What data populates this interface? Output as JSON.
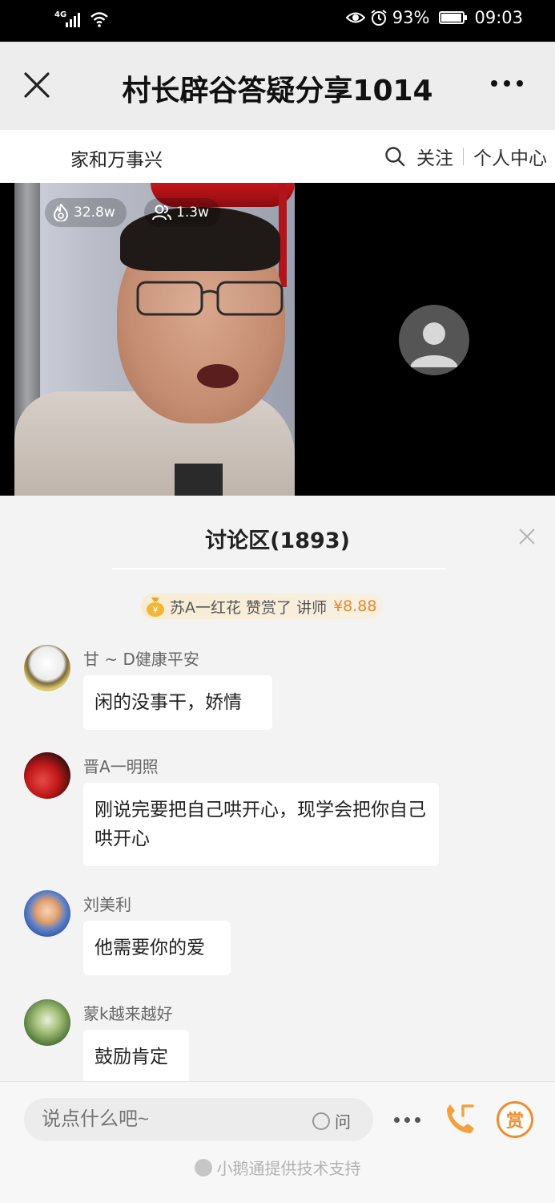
{
  "status_bar": {
    "network": "4G",
    "battery": "93%",
    "battery_level": 0.93,
    "time": "09:03",
    "icons": [
      "signal-icon",
      "wifi-icon",
      "eye-icon",
      "alarm-icon",
      "battery-icon"
    ]
  },
  "header": {
    "title": "村长辟谷答疑分享1014",
    "close_icon": "close-icon",
    "more_icon": "more-icon"
  },
  "channel": {
    "name": "家和万事兴",
    "follow_label": "关注",
    "profile_label": "个人中心"
  },
  "video": {
    "hot_count": "32.8w",
    "viewer_count": "1.3w"
  },
  "discussion": {
    "title": "讨论区(1893)",
    "tip": {
      "text": "苏A一红花 赞赏了 讲师",
      "amount": "¥8.88"
    },
    "messages": [
      {
        "user": "甘 ~ D健康平安",
        "text": "闲的没事干，娇情"
      },
      {
        "user": "晋A一明照",
        "text": "刚说完要把自己哄开心，现学会把你自己哄开心"
      },
      {
        "user": "刘美利",
        "text": "他需要你的爱"
      },
      {
        "user": "蒙k越来越好",
        "text": "鼓励肯定"
      }
    ]
  },
  "footer": {
    "input_placeholder": "说点什么吧~",
    "ask_label": "问",
    "reward_label": "赏",
    "powered_by": "小鹅通提供技术支持"
  },
  "colors": {
    "accent_orange": "#f08c2e",
    "tip_amount": "#e8882c"
  }
}
